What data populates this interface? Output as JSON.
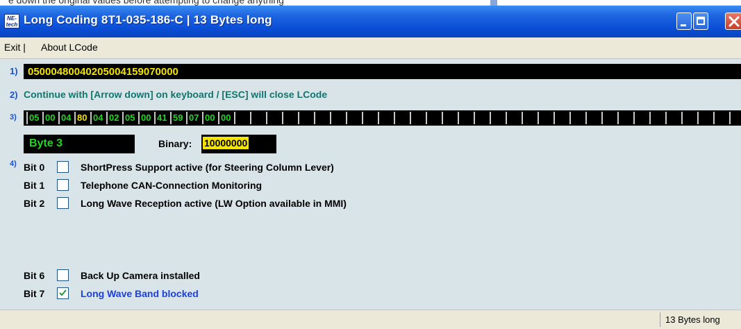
{
  "background_text": "e down the original values before attempting to change anything",
  "window": {
    "icon_text": "NE-tech",
    "title": "Long Coding  8T1-035-186-C  |  13 Bytes long"
  },
  "menu": {
    "exit": "Exit |",
    "about": "About LCode"
  },
  "row_numbers": {
    "r1": "1)",
    "r2": "2)",
    "r3": "3)",
    "r4": "4)"
  },
  "coding_string": "05000480040205004159070000",
  "hint": "Continue with [Arrow down] on keyboard / [ESC] will close LCode",
  "bytes": [
    "05",
    "00",
    "04",
    "80",
    "04",
    "02",
    "05",
    "00",
    "41",
    "59",
    "07",
    "00",
    "00",
    "",
    "",
    "",
    "",
    "",
    "",
    "",
    "",
    "",
    "",
    "",
    "",
    "",
    "",
    "",
    "",
    "",
    "",
    "",
    "",
    "",
    "",
    "",
    "",
    "",
    "",
    "",
    "",
    "",
    "",
    "",
    ""
  ],
  "selected_byte_index": 3,
  "byte_label": "Byte 3",
  "binary_caption": "Binary:",
  "binary_value": "10000000",
  "bits": [
    {
      "label": "Bit 0",
      "text": "ShortPress Support active (for Steering Column Lever)",
      "checked": false
    },
    {
      "label": "Bit 1",
      "text": "Telephone CAN-Connection Monitoring",
      "checked": false
    },
    {
      "label": "Bit 2",
      "text": "Long Wave Reception active (LW Option available in MMI)",
      "checked": false
    },
    {
      "label": "Bit 6",
      "text": "Back Up Camera installed",
      "checked": false
    },
    {
      "label": "Bit 7",
      "text": "Long Wave Band blocked",
      "checked": true
    }
  ],
  "status": "13 Bytes long",
  "colors": {
    "title_bar": "#0a4fd6",
    "panel": "#d9e4e8",
    "byte_value": "#22d622",
    "selected_byte": "#f5e400",
    "checked_text": "#1a3ee0"
  }
}
